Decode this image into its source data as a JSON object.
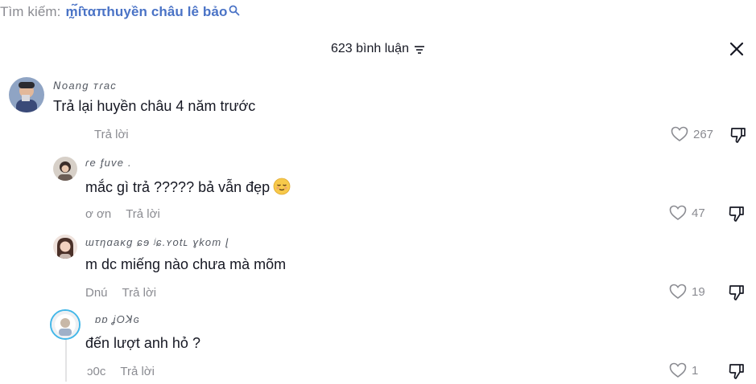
{
  "search": {
    "label": "Tìm kiếm:",
    "term": "m̰̃́ί̂ταπhuyền châu lê bảo",
    "icon": "search-icon"
  },
  "sheet": {
    "title": "623 bình luận",
    "sort_icon": "sort-icon",
    "close_icon": "close-icon"
  },
  "colors": {
    "accent_link": "#4a73c6",
    "muted": "#8a8b91",
    "text": "#161823"
  },
  "comments": [
    {
      "username": "ꓠoang ᴛɾac",
      "text": "Trả lại huyền châu 4 năm trước",
      "meta": "",
      "reply_label": "Trả lời",
      "likes": "267"
    },
    {
      "username": "ɾe ᶂuve .",
      "text": "mắc gì trả ????? bả vẫn đẹp",
      "emoji": "relieved-face",
      "meta": "ơ ơn",
      "reply_label": "Trả lời",
      "likes": "47"
    },
    {
      "username": "ɯτηɑaκɡ ɕɘ ʲɕ.ʏotʟ ɣkom ɭ",
      "text": "m dc miếng nào chưa mà mõm",
      "meta": "Dnú",
      "reply_label": "Trả lời",
      "likes": "19"
    },
    {
      "username": "ɒɒ ʝOꓘɢ",
      "text": "đến lượt anh hỏ ?",
      "meta": "ɔ0c",
      "reply_label": "Trả lời",
      "likes": "1"
    }
  ]
}
